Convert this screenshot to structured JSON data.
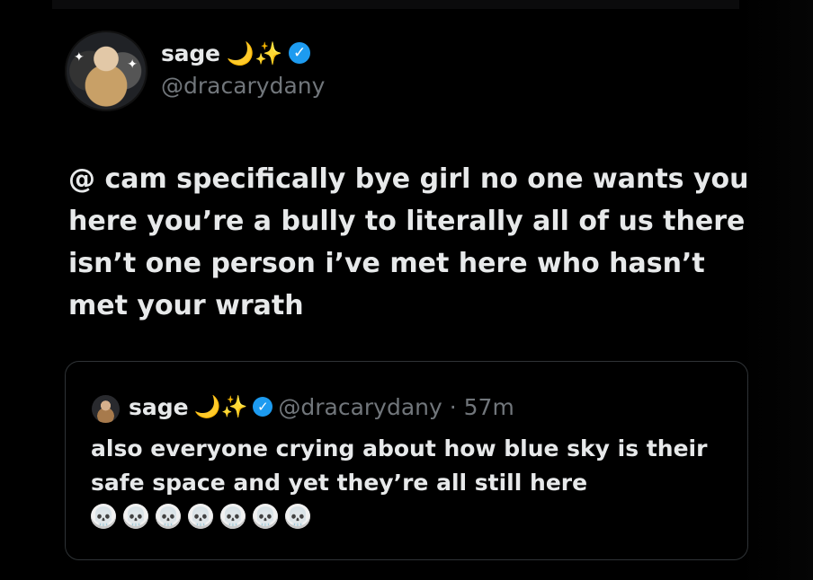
{
  "post": {
    "display_name": "sage",
    "name_emoji": "🌙✨",
    "verified_symbol": "✓",
    "handle": "@dracarydany",
    "text": "@ cam specifically bye girl no one wants you here you’re a bully to literally all of us there isn’t one person i’ve met here who hasn’t met your wrath"
  },
  "quote": {
    "display_name": "sage",
    "name_emoji": "🌙✨",
    "verified_symbol": "✓",
    "meta": "@dracarydany · 57m",
    "text": "also everyone crying about how blue sky is their safe space and yet they’re all still here",
    "skulls": [
      "💀",
      "💀",
      "💀",
      "💀",
      "💀",
      "💀",
      "💀"
    ]
  },
  "colors": {
    "background": "#000000",
    "text": "#e7e9ea",
    "secondary_text": "#71767b",
    "verified": "#1d9bf0",
    "card_border": "#2f3336"
  },
  "icons": {
    "avatar": "profile-photo",
    "verified": "verified-check-icon",
    "emoji": "moon-sparkle-emoji",
    "skull": "skull-emoji"
  }
}
